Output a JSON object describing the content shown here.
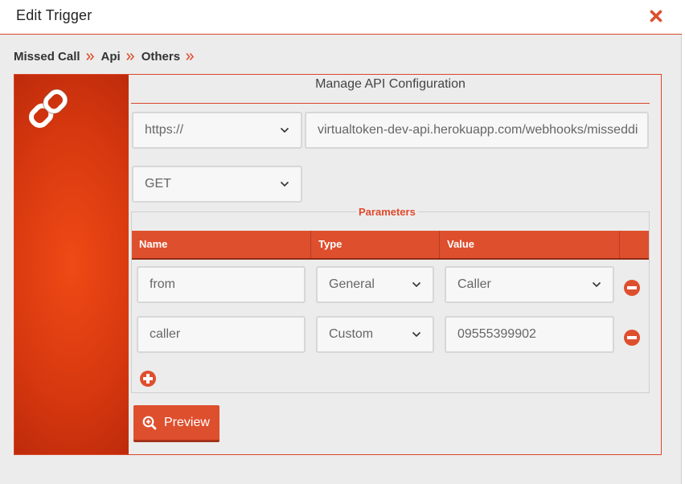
{
  "modal": {
    "title": "Edit Trigger"
  },
  "breadcrumb": [
    {
      "label": "Missed Call"
    },
    {
      "label": "Api"
    },
    {
      "label": "Others"
    }
  ],
  "config": {
    "title": "Manage API Configuration",
    "protocol": "https://",
    "url": "virtualtoken-dev-api.herokuapp.com/webhooks/misseddi",
    "method": "GET"
  },
  "parameters": {
    "legend": "Parameters",
    "headers": {
      "name": "Name",
      "type": "Type",
      "value": "Value"
    },
    "rows": [
      {
        "name": "from",
        "type": "General",
        "value": "Caller",
        "value_kind": "select"
      },
      {
        "name": "caller",
        "type": "Custom",
        "value": "09555399902",
        "value_kind": "input"
      }
    ]
  },
  "preview_button": {
    "label": "Preview"
  },
  "colors": {
    "accent": "#de4f2e",
    "border_accent": "#d9472b",
    "sidebar": "#d7380f",
    "background": "#ececec"
  },
  "icons": {
    "close": "close-icon",
    "link": "link-icon",
    "breadcrumb_separator": "double-chevron-right-icon",
    "remove": "minus-circle-icon",
    "add": "plus-circle-icon",
    "preview": "zoom-in-icon"
  }
}
